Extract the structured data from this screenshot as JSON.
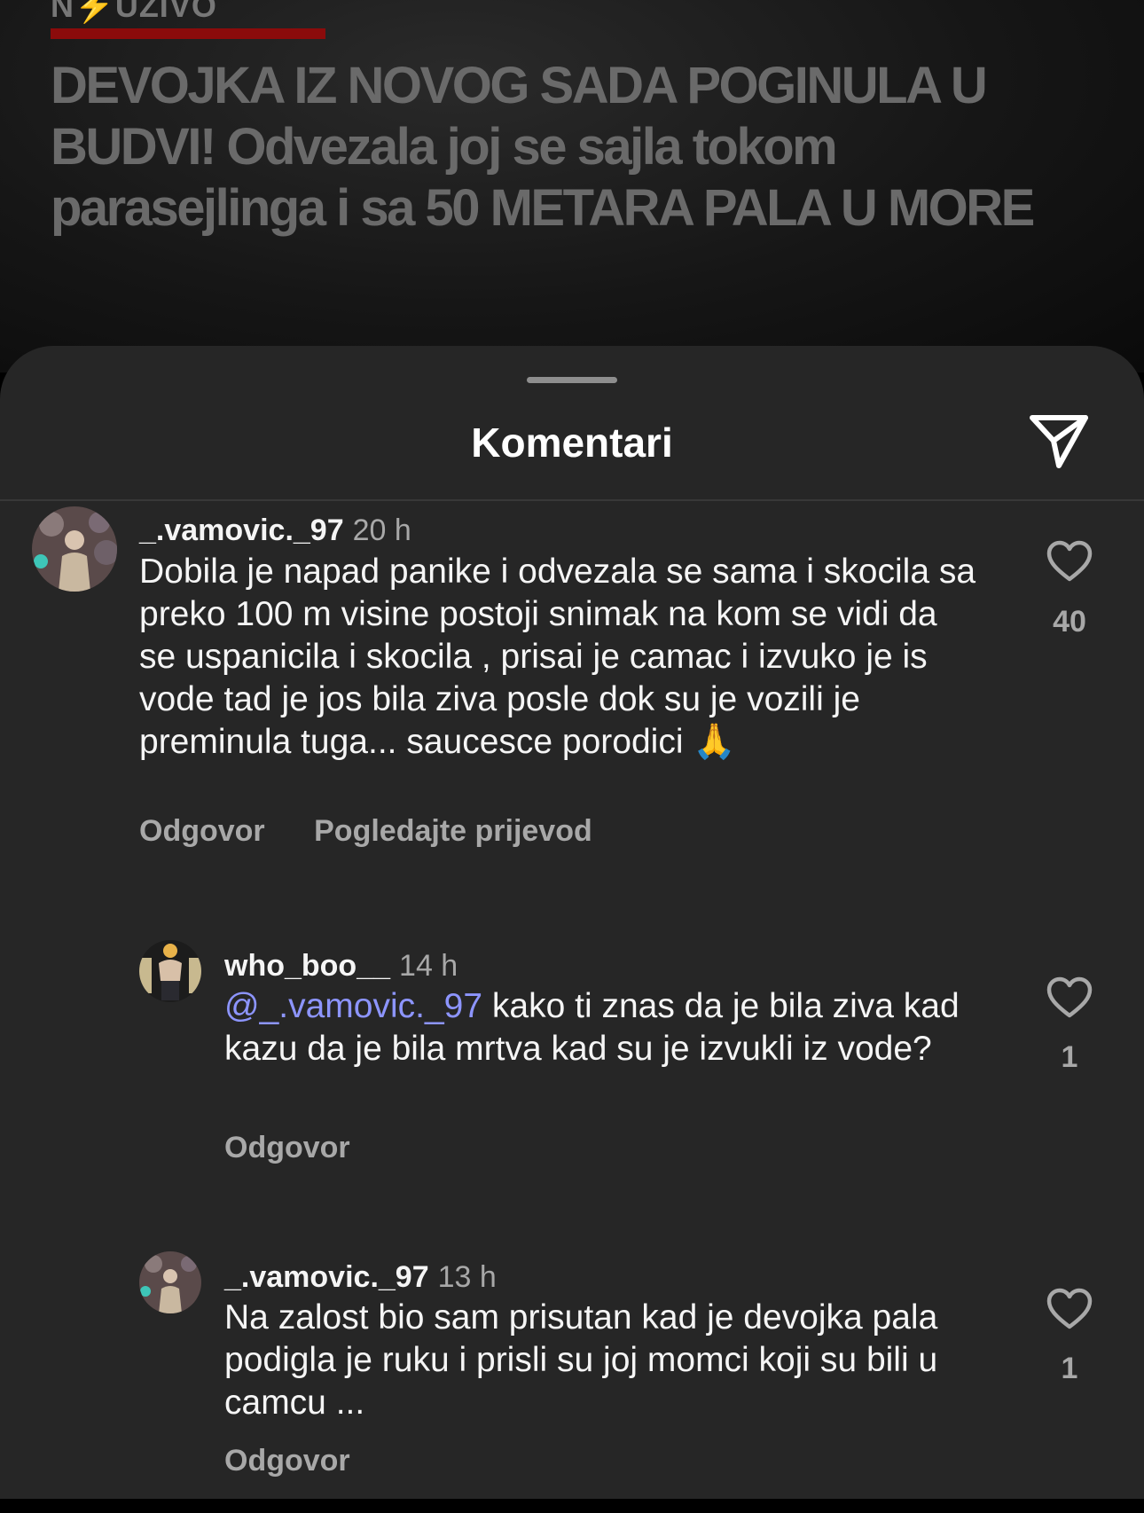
{
  "background_post": {
    "brand": "N⚡UZIVO",
    "headline": "DEVOJKA IZ NOVOG SADA POGINULA U BUDVI! Odvezala joj se sajla tokom parasejlinga i sa 50 METARA PALA U MORE"
  },
  "sheet": {
    "title": "Komentari",
    "share_icon": "send-icon"
  },
  "comments": [
    {
      "username": "_.vamovic._97",
      "time": "20 h",
      "text": "Dobila je napad panike i odvezala se sama i skocila sa preko 100 m visine postoji snimak na kom se vidi da se uspanicila i skocila , prisai je camac i izvuko je is vode tad je jos bila ziva posle dok su je vozili je preminula tuga... saucesce porodici 🙏",
      "reply_label": "Odgovor",
      "translate_label": "Pogledajte prijevod",
      "likes": "40"
    },
    {
      "username": "who_boo__",
      "time": "14 h",
      "mention": "@_.vamovic._97",
      "text": " kako ti znas da je bila ziva kad kazu da je bila mrtva kad su je izvukli iz vode?",
      "reply_label": "Odgovor",
      "likes": "1"
    },
    {
      "username": "_.vamovic._97",
      "time": "13 h",
      "text": "Na zalost bio sam prisutan kad je devojka pala podigla je ruku i prisli su joj momci koji su bili u camcu ...",
      "reply_label": "Odgovor",
      "likes": "1"
    }
  ],
  "colors": {
    "sheet_bg": "#262626",
    "mention": "#8d95ff",
    "secondary_text": "#a8a8a8",
    "brand_red": "#8b0b0b"
  }
}
